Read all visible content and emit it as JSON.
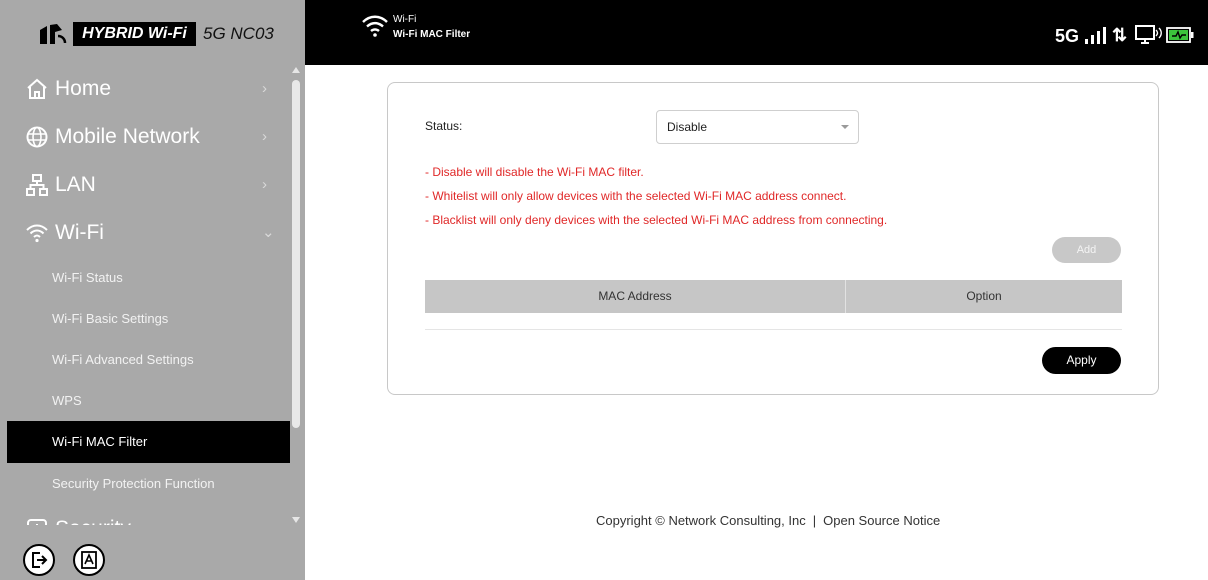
{
  "brand": {
    "logo_icon": "hybrid-logo-icon",
    "product": "HYBRID Wi-Fi",
    "model": "5G NC03"
  },
  "sidebar": {
    "items": [
      {
        "icon": "home-icon",
        "label": "Home",
        "chevron": "›"
      },
      {
        "icon": "globe-icon",
        "label": "Mobile Network",
        "chevron": "›"
      },
      {
        "icon": "lan-icon",
        "label": "LAN",
        "chevron": "›"
      },
      {
        "icon": "wifi-icon",
        "label": "Wi-Fi",
        "chevron": "⌄"
      },
      {
        "icon": "security-icon",
        "label": "Security",
        "chevron": "›"
      }
    ],
    "wifi_submenu": [
      {
        "label": "Wi-Fi Status"
      },
      {
        "label": "Wi-Fi Basic Settings"
      },
      {
        "label": "Wi-Fi Advanced Settings"
      },
      {
        "label": "WPS"
      },
      {
        "label": "Wi-Fi MAC Filter",
        "active": true
      },
      {
        "label": "Security Protection Function"
      }
    ],
    "footer_buttons": [
      "logout-icon",
      "font-size-icon"
    ]
  },
  "topbar": {
    "section": "Wi-Fi",
    "page": "Wi-Fi MAC Filter",
    "network_type": "5G",
    "signal_icon": "signal-bars-icon",
    "data_transfer_icon": "up-down-arrows",
    "data_transfer_glyph": "⇅",
    "device_icon": "connected-device-icon",
    "battery_icon": "battery-charging-icon"
  },
  "form": {
    "status_label": "Status:",
    "status_value": "Disable",
    "notes": [
      "- Disable will disable the Wi-Fi MAC filter.",
      "- Whitelist will only allow devices with the selected Wi-Fi MAC address connect.",
      "- Blacklist will only deny devices with the selected Wi-Fi MAC address from connecting."
    ],
    "add_label": "Add",
    "columns": [
      "MAC Address",
      "Option"
    ],
    "apply_label": "Apply"
  },
  "footer": {
    "copyright": "Copyright © Network Consulting, Inc",
    "separator": "|",
    "open_source": "Open Source Notice"
  },
  "colors": {
    "sidebar_bg": "#a9a9a9",
    "topbar_bg": "#000000",
    "note_red": "#e02828",
    "active_bg": "#000000",
    "battery_green": "#3cc43c"
  }
}
